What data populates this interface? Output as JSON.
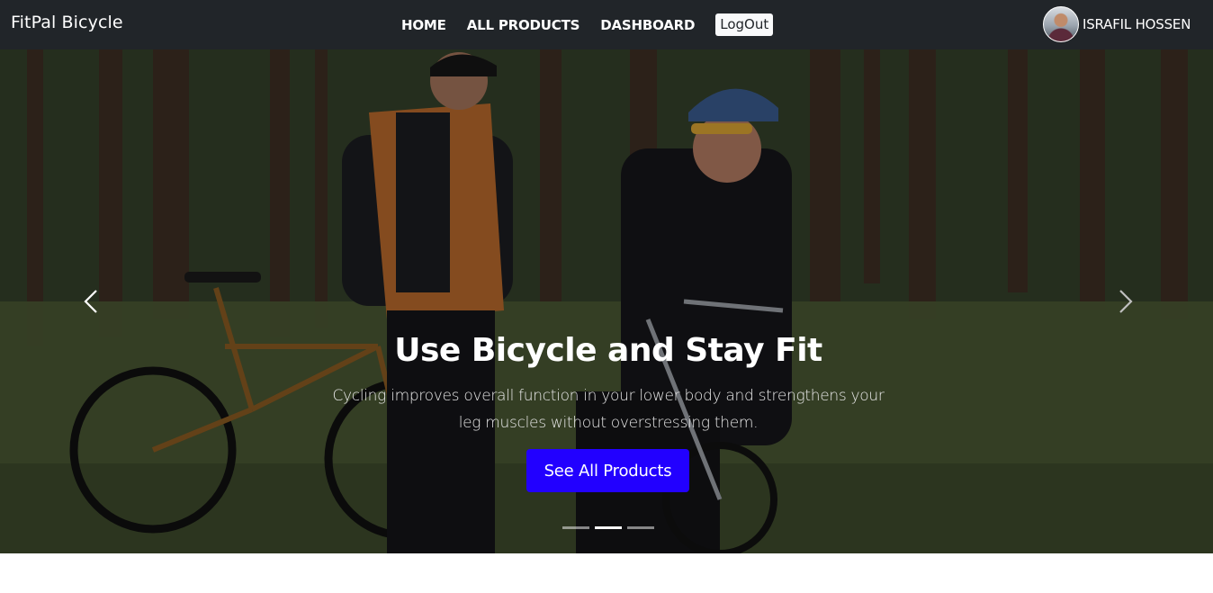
{
  "navbar": {
    "brand": "FitPal Bicycle",
    "links": [
      "HOME",
      "ALL PRODUCTS",
      "DASHBOARD"
    ],
    "logout_label": "LogOut",
    "user_name": "ISRAFIL HOSSEN"
  },
  "hero": {
    "title": "Use Bicycle and Stay Fit",
    "text": "Cycling improves overall function in your lower body and strengthens your leg muscles without overstressing them.",
    "button_label": "See All Products",
    "active_slide": 2,
    "slide_count": 3
  },
  "icons": {
    "prev": "chevron-left-icon",
    "next": "chevron-right-icon"
  },
  "colors": {
    "navbar_bg": "#212529",
    "cta_bg": "#2200ff",
    "logout_bg": "#f8f9fa"
  }
}
